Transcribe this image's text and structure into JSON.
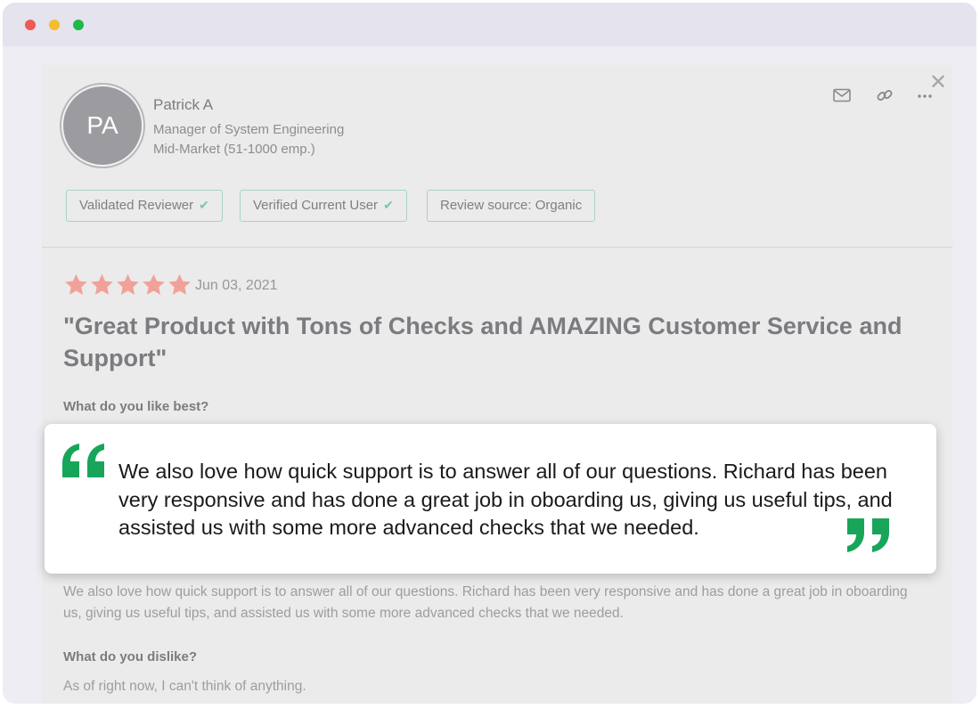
{
  "window": {
    "controls": {
      "close_color": "#ee5a56",
      "minimize_color": "#f3bd2e",
      "maximize_color": "#1fb84a"
    }
  },
  "reviewer": {
    "initials": "PA",
    "name": "Patrick A",
    "role": "Manager of System Engineering",
    "segment": "Mid-Market (51-1000 emp.)"
  },
  "header_actions": {
    "email_icon": "envelope-icon",
    "link_icon": "link-icon",
    "more_icon": "ellipsis-icon",
    "close_icon": "close-icon"
  },
  "badges": [
    {
      "label": "Validated Reviewer",
      "verified": true
    },
    {
      "label": "Verified Current User",
      "verified": true
    },
    {
      "label": "Review source: Organic",
      "verified": false
    }
  ],
  "review": {
    "rating": 5,
    "max_rating": 5,
    "star_color": "#f0a29a",
    "date": "Jun 03, 2021",
    "title": "\"Great Product with Tons of Checks and AMAZING Customer Service and Support\"",
    "like_question": "What do you like best?",
    "like_answer": "We also love how quick support is to answer all of our questions. Richard has been very responsive and has done a great job in oboarding us, giving us useful tips, and assisted us with some more advanced checks that we needed.",
    "dislike_question": "What do you dislike?",
    "dislike_answer": "As of right now, I can't think of anything."
  },
  "highlight_quote": {
    "text": "We also love how quick support is to answer all of our questions. Richard has been very responsive and has done a great job in oboarding us, giving us useful tips, and assisted us with some more advanced checks that we needed.",
    "quote_color": "#18a55a"
  }
}
